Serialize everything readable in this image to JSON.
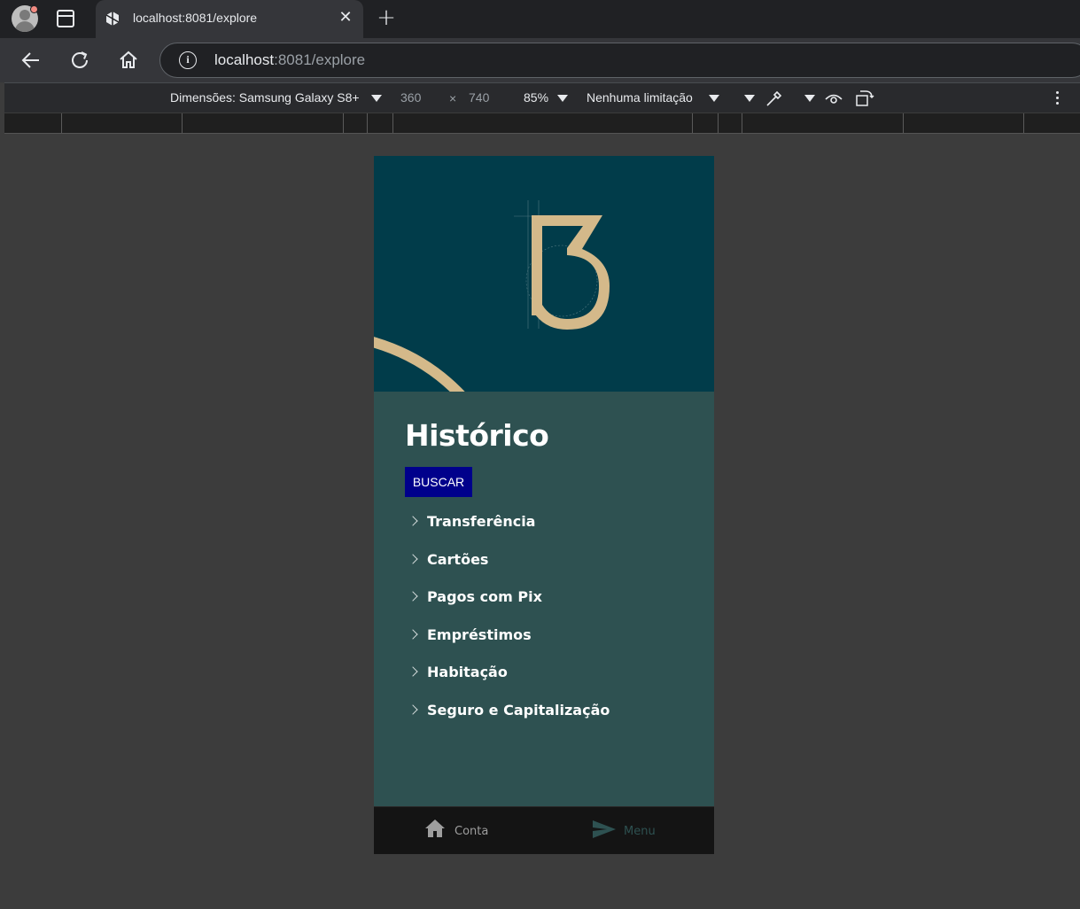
{
  "browser": {
    "tab_title": "localhost:8081/explore",
    "url_host": "localhost",
    "url_rest": ":8081/explore",
    "close_symbol": "✕",
    "new_tab_symbol": "+"
  },
  "devtools": {
    "dimensions_label": "Dimensões: Samsung Galaxy S8+",
    "width": "360",
    "times": "×",
    "height": "740",
    "zoom": "85%",
    "throttle": "Nenhuma limitação"
  },
  "app": {
    "title": "Histórico",
    "search_button": "BUSCAR",
    "menu_items": [
      {
        "label": "Transferência"
      },
      {
        "label": "Cartões"
      },
      {
        "label": "Pagos com Pix"
      },
      {
        "label": "Empréstimos"
      },
      {
        "label": "Habitação"
      },
      {
        "label": "Seguro e Capitalização"
      }
    ],
    "bottom_nav": [
      {
        "label": "Conta",
        "icon": "home-icon",
        "active": true
      },
      {
        "label": "Menu",
        "icon": "send-icon",
        "active": false
      }
    ]
  },
  "colors": {
    "hero_bg": "#013c4a",
    "content_bg": "#2e5151",
    "logo_gold": "#d4b98a",
    "button_bg": "#00008b",
    "nav_bg": "#141414"
  }
}
